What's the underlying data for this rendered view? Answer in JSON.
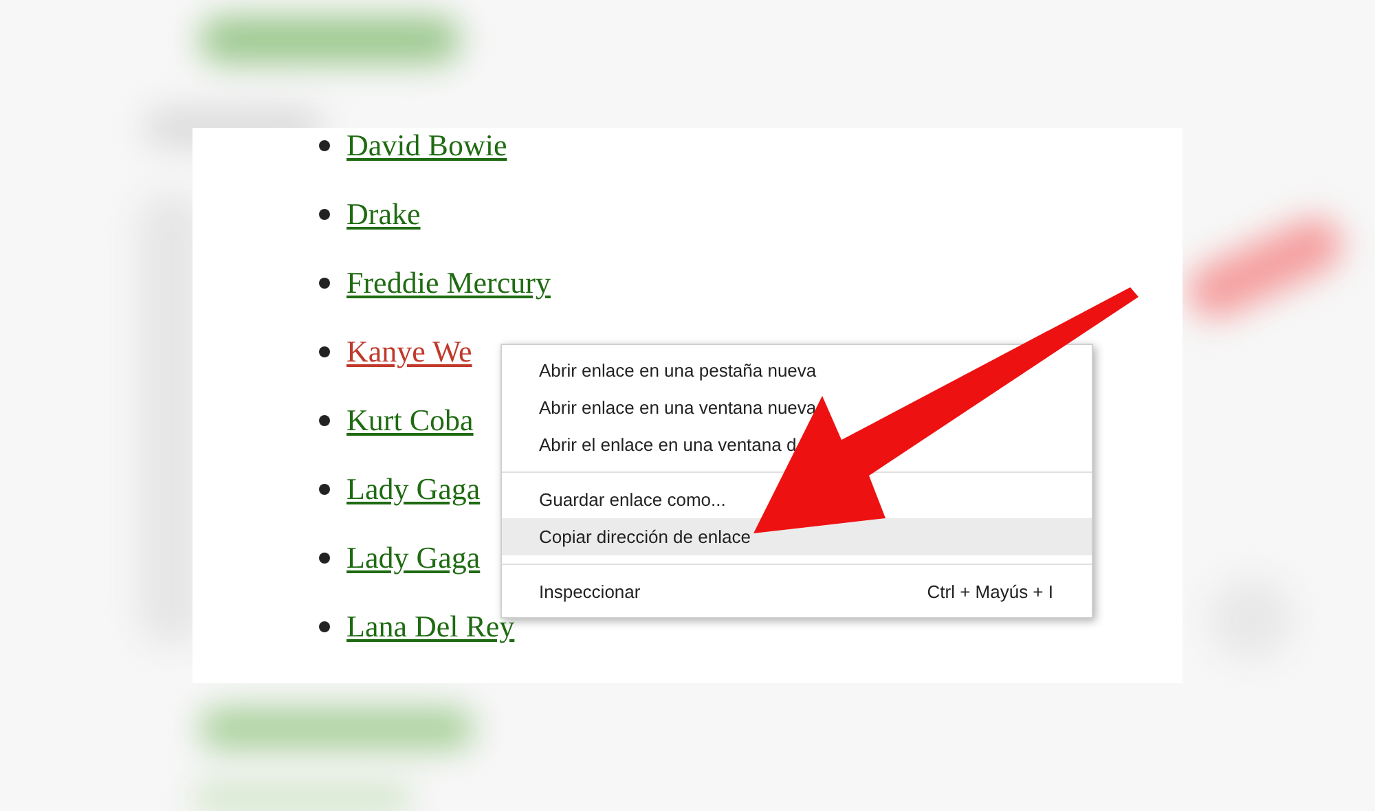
{
  "links": [
    {
      "label": "David Bowie",
      "visited": false
    },
    {
      "label": "Drake",
      "visited": false
    },
    {
      "label": "Freddie Mercury",
      "visited": false
    },
    {
      "label": "Kanye We",
      "visited": true
    },
    {
      "label": "Kurt Coba",
      "visited": false
    },
    {
      "label": "Lady Gaga",
      "visited": false
    },
    {
      "label": "Lady Gaga",
      "visited": false
    },
    {
      "label": "Lana Del Rey",
      "visited": false
    }
  ],
  "context_menu": {
    "groups": [
      [
        {
          "label": "Abrir enlace en una pestaña nueva",
          "selected": false
        },
        {
          "label": "Abrir enlace en una ventana nueva",
          "selected": false
        },
        {
          "label": "Abrir el enlace en una ventana d",
          "selected": false
        }
      ],
      [
        {
          "label": "Guardar enlace como...",
          "selected": false
        },
        {
          "label": "Copiar dirección de enlace",
          "selected": true
        }
      ],
      [
        {
          "label": "Inspeccionar",
          "shortcut": "Ctrl + Mayús + I",
          "selected": false
        }
      ]
    ]
  }
}
